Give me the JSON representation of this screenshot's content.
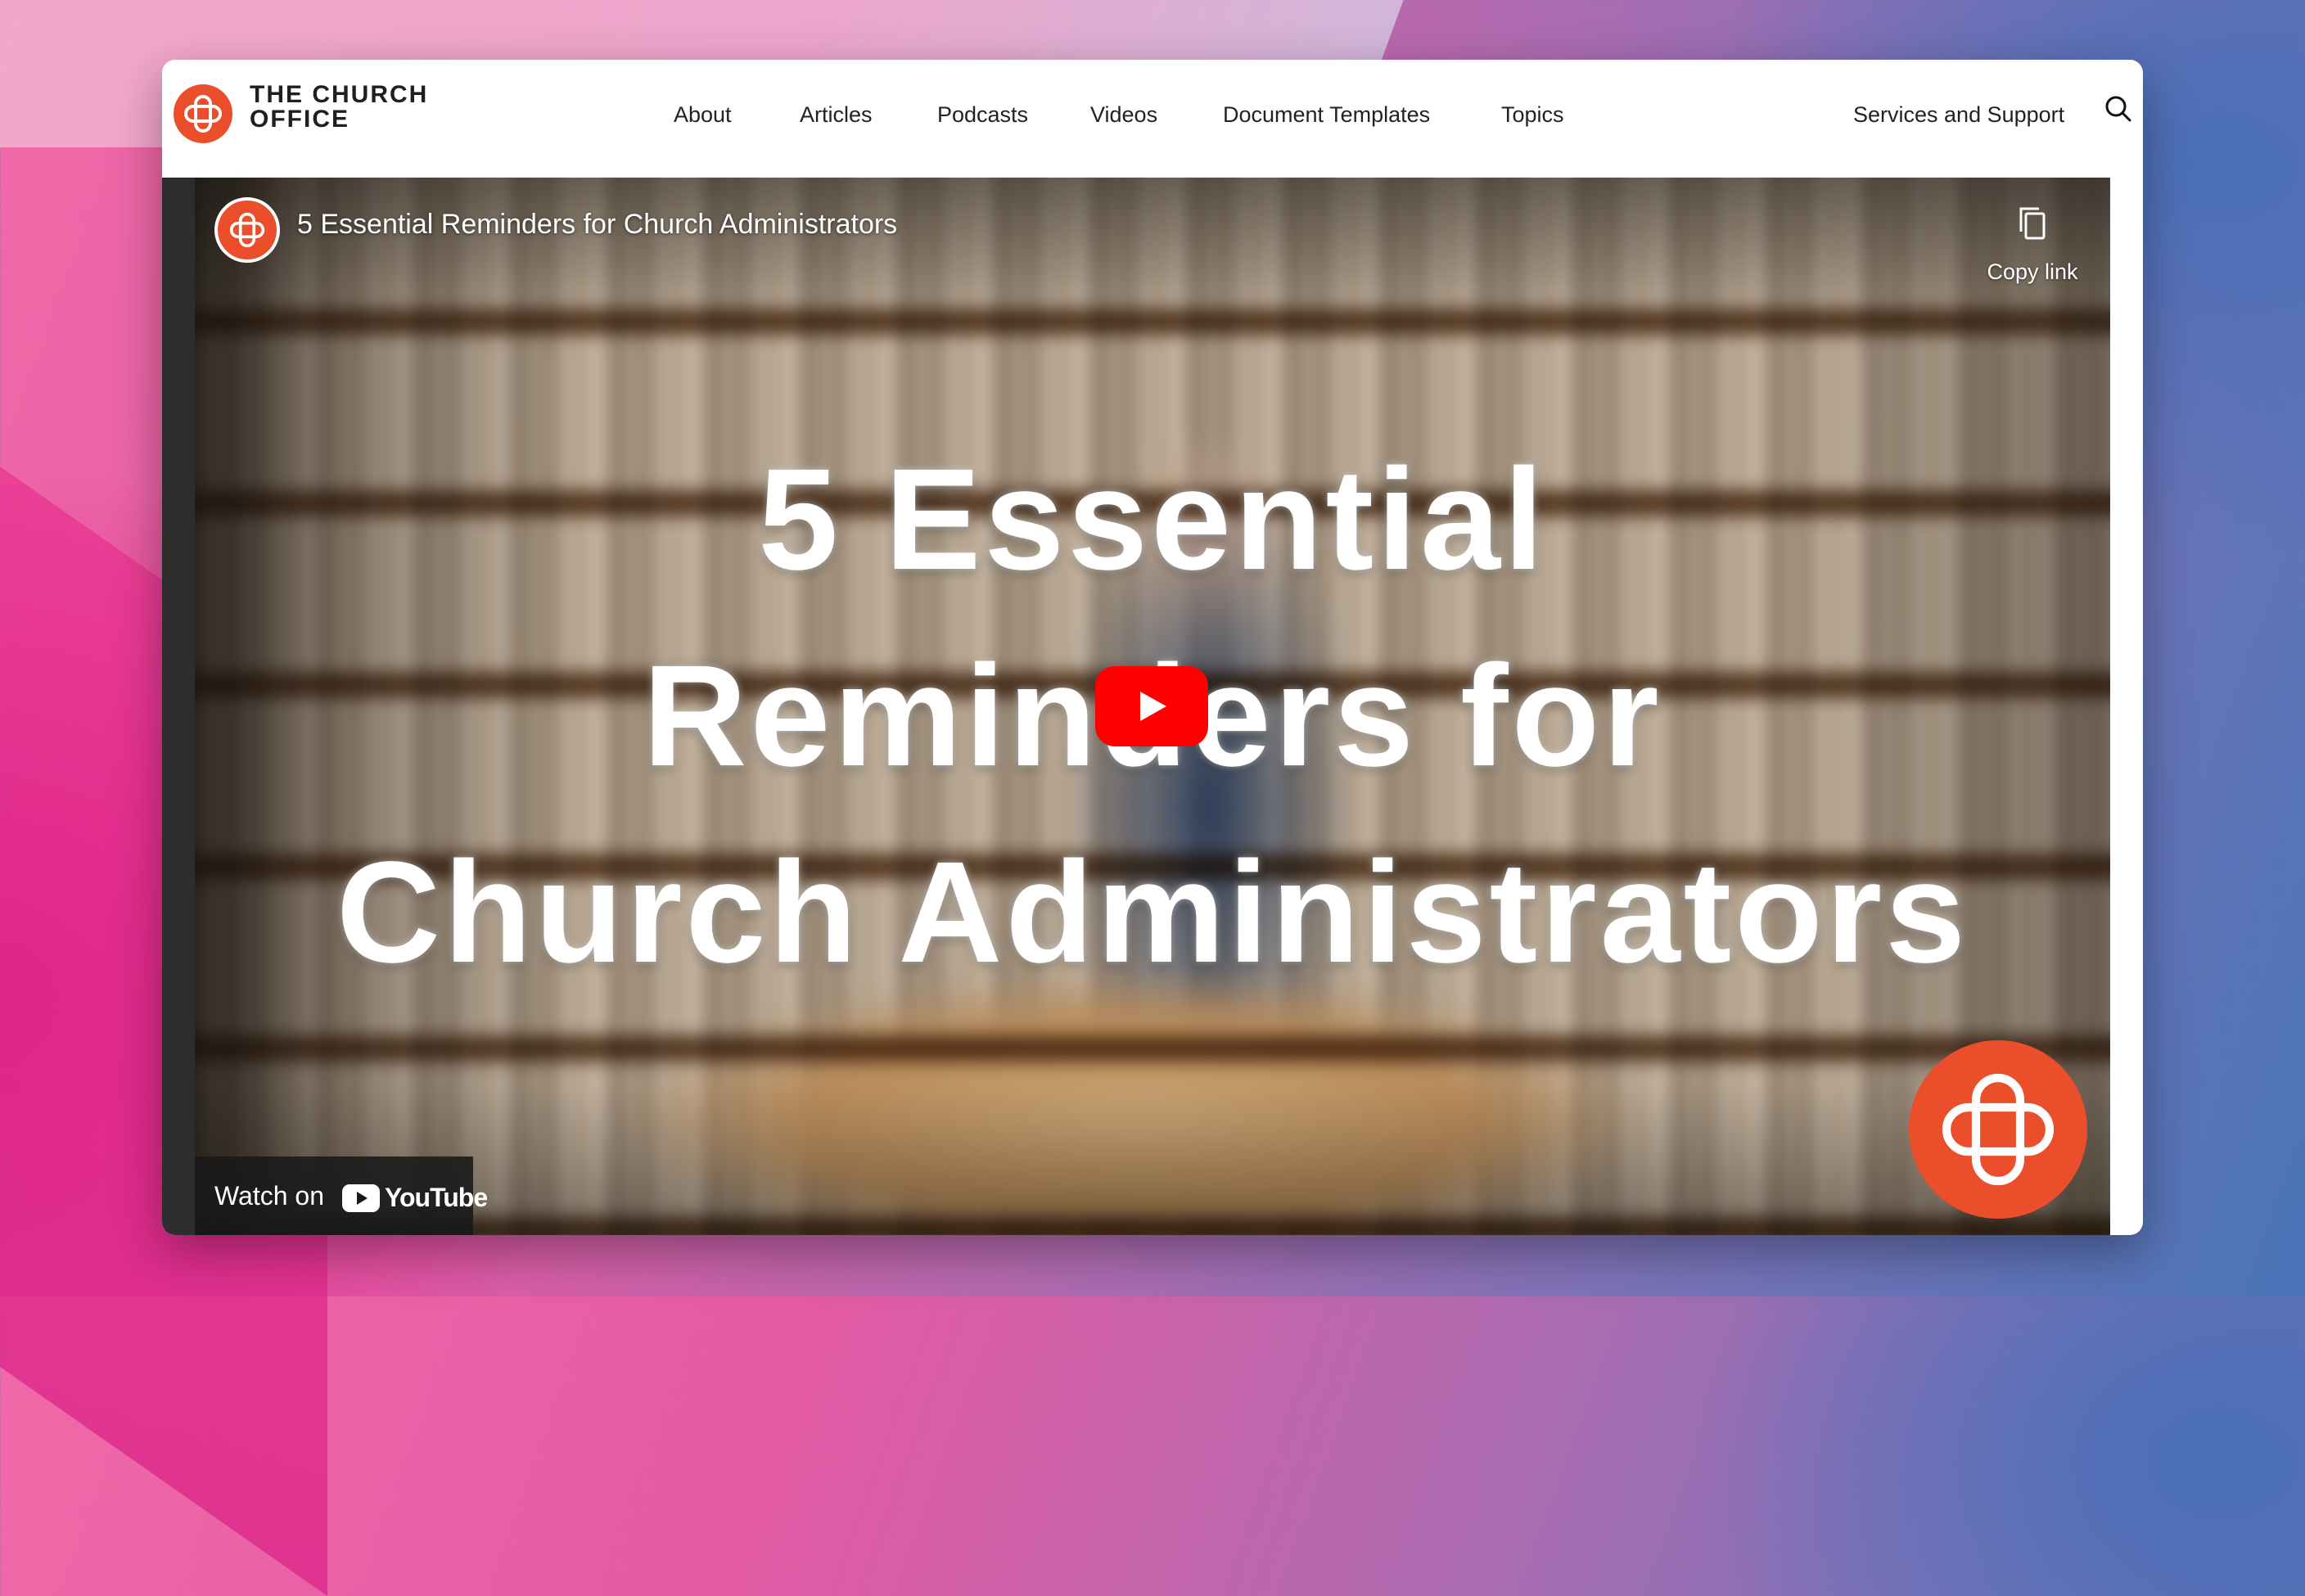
{
  "site": {
    "brand_line1": "THE CHURCH",
    "brand_line2": "OFFICE",
    "brand_color": "#ea4e2a"
  },
  "nav": {
    "items": [
      {
        "label": "About"
      },
      {
        "label": "Articles"
      },
      {
        "label": "Podcasts"
      },
      {
        "label": "Videos"
      },
      {
        "label": "Document Templates"
      },
      {
        "label": "Topics"
      }
    ],
    "right_item": "Services and Support",
    "search_icon": "search-icon"
  },
  "video": {
    "header_title": "5 Essential Reminders for Church Administrators",
    "copy_link_label": "Copy link",
    "overlay_title_lines": [
      "5 Essential",
      "Reminders for",
      "Church Administrators"
    ],
    "play_color": "#ff0000",
    "watch_on_label": "Watch on",
    "youtube_wordmark": "YouTube"
  }
}
